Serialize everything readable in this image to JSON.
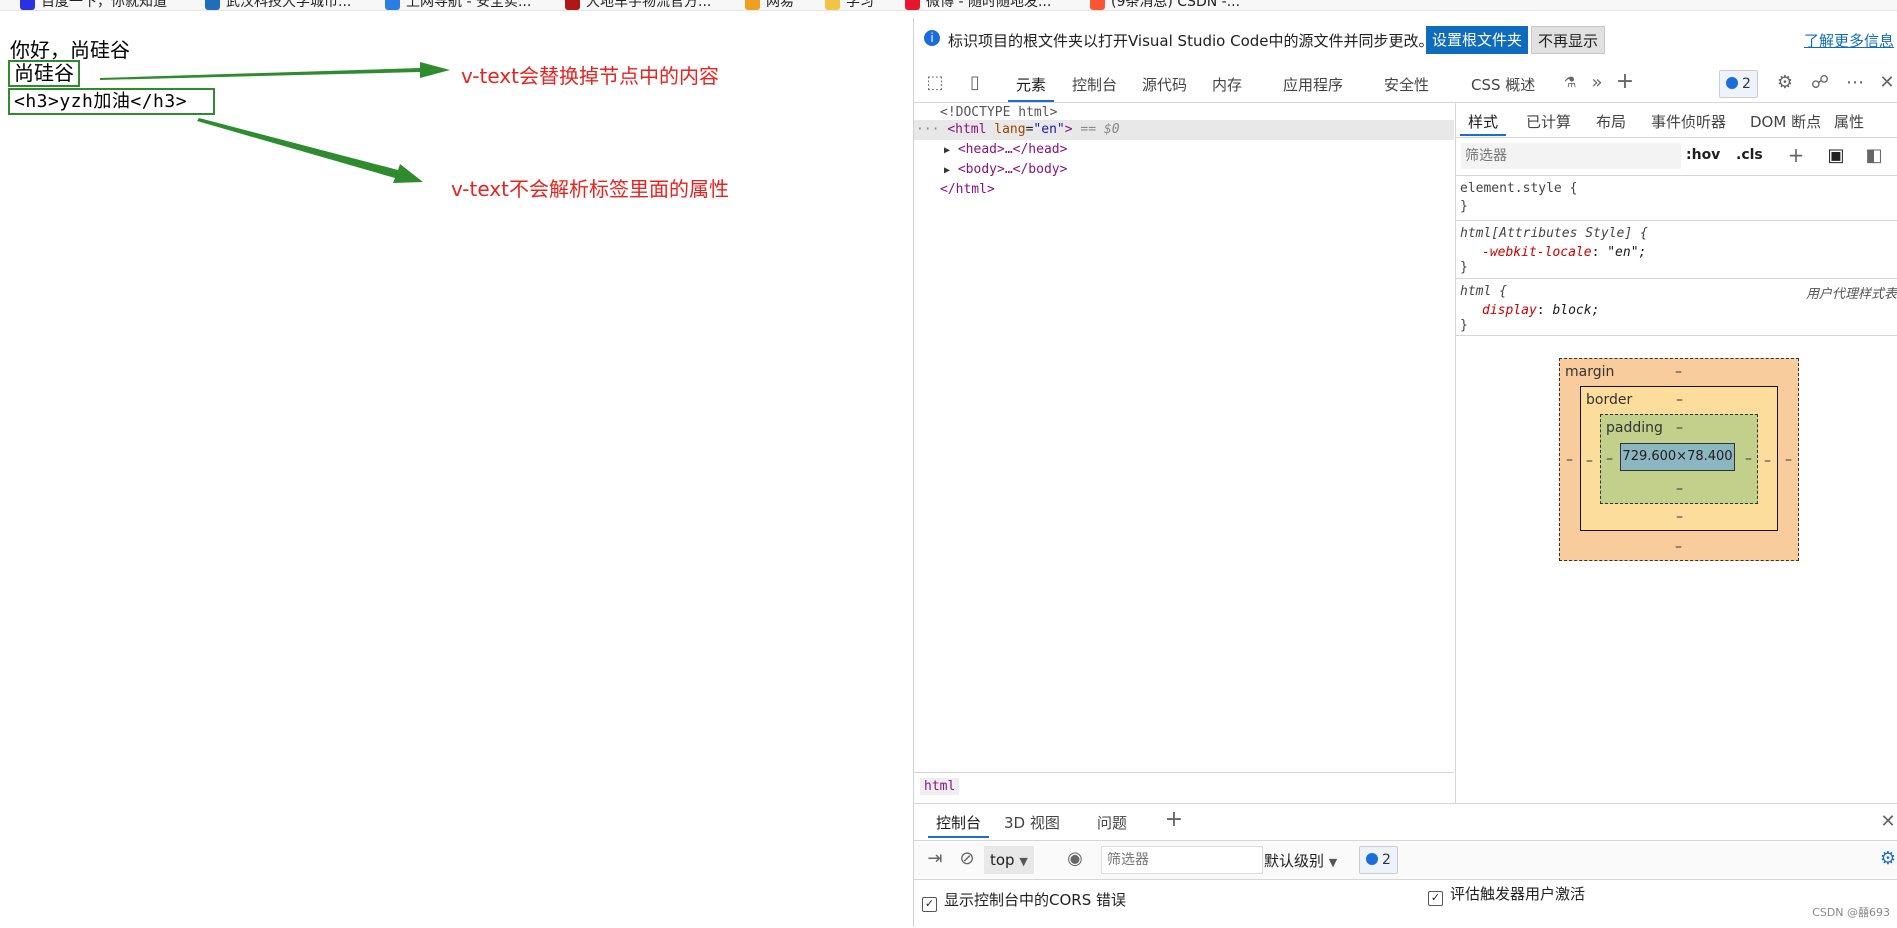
{
  "bookmarks": [
    "百度一下，你就知道",
    "武汉科技大学城市...",
    "上网导航 - 安全实...",
    "大地车宇物流官方...",
    "网易",
    "学习",
    "微博 - 随时随地发...",
    "(9条消息) CSDN -..."
  ],
  "page": {
    "line1": "你好，尚硅谷",
    "line2": "尚硅谷",
    "line3": "<h3>yzh加油</h3>",
    "note1": "v-text会替换掉节点中的内容",
    "note2": "v-text不会解析标签里面的属性"
  },
  "devtools": {
    "infobar": {
      "message": "标识项目的根文件夹以打开Visual Studio Code中的源文件并同步更改。",
      "set_root": "设置根文件夹",
      "dont_show": "不再显示",
      "learn_more": "了解更多信息"
    },
    "tabs": [
      "元素",
      "控制台",
      "源代码",
      "内存",
      "应用程序",
      "安全性",
      "CSS 概述"
    ],
    "issues_count": "2",
    "dom": {
      "doctype": "<!DOCTYPE html>",
      "html_open_tag": "<html",
      "lang_attr": "lang",
      "lang_value": "\"en\"",
      "html_close_bracket": ">",
      "selected_marker": "== $0",
      "head": "<head>…</head>",
      "body": "<body>…</body>",
      "html_close": "</html>"
    },
    "breadcrumb": "html",
    "styles": {
      "tabs": [
        "样式",
        "已计算",
        "布局",
        "事件侦听器",
        "DOM 断点",
        "属性"
      ],
      "filter_placeholder": "筛选器",
      "hov": ":hov",
      "cls": ".cls",
      "rules": [
        {
          "selector": "element.style {",
          "close": "}"
        },
        {
          "selector": "html[Attributes Style] {",
          "prop": "-webkit-locale",
          "value": "\"en\";",
          "close": "}"
        },
        {
          "selector": "html {",
          "source": "用户代理样式表",
          "prop": "display",
          "value": "block;",
          "close": "}"
        }
      ],
      "box_model": {
        "margin": "margin",
        "border": "border",
        "padding": "padding",
        "content": "729.600×78.400",
        "dash": "–"
      }
    },
    "drawer": {
      "tabs": [
        "控制台",
        "3D 视图",
        "问题"
      ],
      "context": "top",
      "filter_placeholder": "筛选器",
      "level": "默认级别",
      "issues_count": "2",
      "cors_label": "显示控制台中的CORS 错误",
      "eval_label": "评估触发器用户激活"
    }
  },
  "watermark": "CSDN @囍693"
}
